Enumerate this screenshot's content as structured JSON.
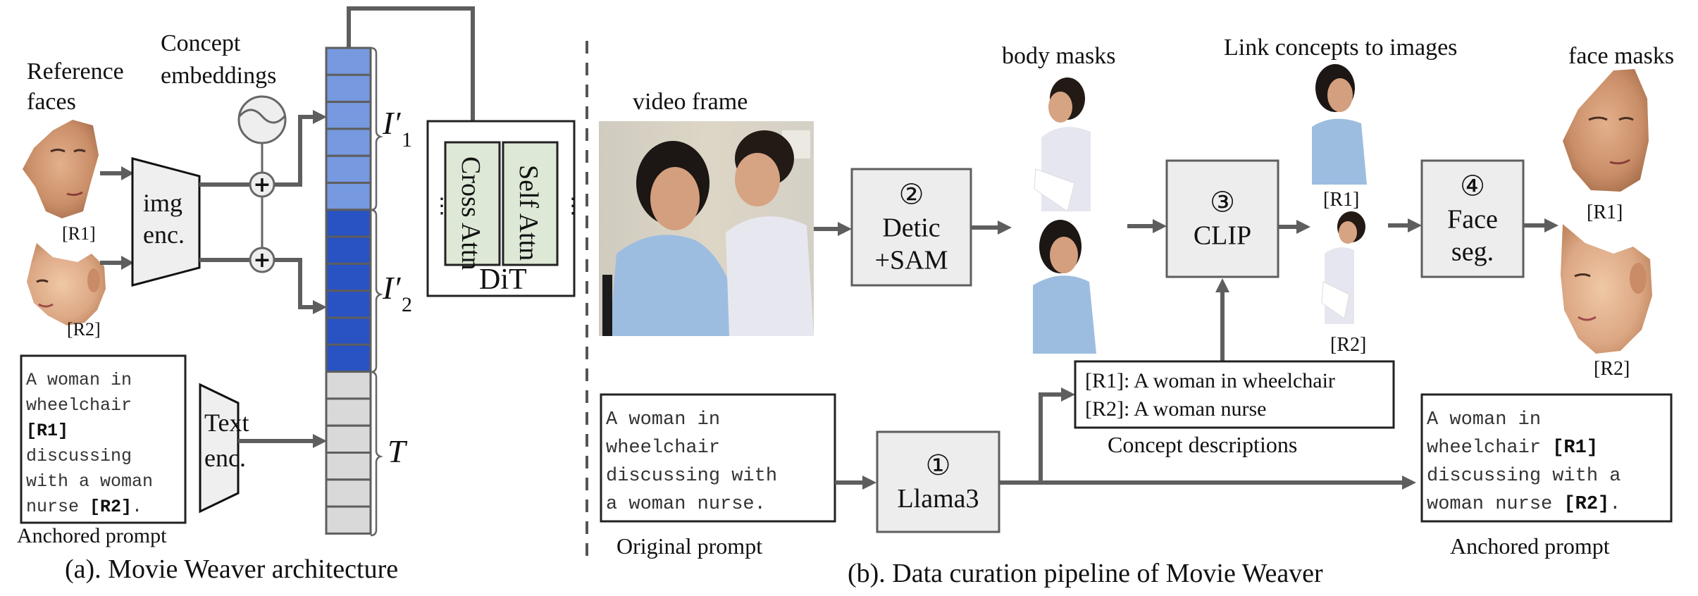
{
  "colors": {
    "token_image_1": "#7699e0",
    "token_image_2": "#2952c2",
    "token_text": "#d9d9d9",
    "module_fill": "#ededed",
    "attention_fill": "#dde8d6",
    "arrow": "#5e5e5e"
  },
  "panel_a": {
    "caption": "(a). Movie Weaver architecture",
    "reference_faces_label_line1": "Reference",
    "reference_faces_label_line2": "faces",
    "concept_embeddings_label_line1": "Concept",
    "concept_embeddings_label_line2": "embeddings",
    "face_r1_tag": "[R1]",
    "face_r2_tag": "[R2]",
    "img_encoder_line1": "img",
    "img_encoder_line2": "enc.",
    "text_encoder_line1": "Text",
    "text_encoder_line2": "enc.",
    "plus_symbol": "+",
    "token_group_labels": {
      "i1": "I′",
      "i1_sub": "1",
      "i2": "I′",
      "i2_sub": "2",
      "t": "T"
    },
    "token_counts": {
      "image_1": 6,
      "image_2": 6,
      "text": 6
    },
    "anchored_prompt": {
      "lines": [
        {
          "text": "A woman in",
          "bold": ""
        },
        {
          "text": "wheelchair",
          "bold": ""
        },
        {
          "text": "",
          "bold": "[R1]"
        },
        {
          "text": "discussing",
          "bold": ""
        },
        {
          "text": "with a woman",
          "bold": ""
        },
        {
          "text": "nurse ",
          "bold": "[R2]",
          "suffix": "."
        }
      ],
      "label": "Anchored prompt"
    },
    "dit": {
      "label": "DiT",
      "cross_attn": "Cross Attn",
      "self_attn": "Self Attn",
      "ellipsis": "⋮"
    }
  },
  "panel_b": {
    "caption": "(b). Data curation pipeline of Movie Weaver",
    "video_frame_label": "video frame",
    "body_masks_label": "body masks",
    "link_label": "Link concepts to images",
    "face_masks_label": "face masks",
    "steps": [
      {
        "number": "①",
        "name": "Llama3",
        "name2": ""
      },
      {
        "number": "②",
        "name": "Detic",
        "name2": "+SAM"
      },
      {
        "number": "③",
        "name": "CLIP",
        "name2": ""
      },
      {
        "number": "④",
        "name": "Face",
        "name2": "seg."
      }
    ],
    "linked_r1_tag": "[R1]",
    "linked_r2_tag": "[R2]",
    "face_r1_tag": "[R1]",
    "face_r2_tag": "[R2]",
    "original_prompt": {
      "lines": [
        "A woman in",
        "wheelchair",
        "discussing with",
        "a woman nurse."
      ],
      "label": "Original prompt"
    },
    "concept_descriptions": {
      "lines": [
        "[R1]: A woman in wheelchair",
        "[R2]: A woman nurse"
      ],
      "label": "Concept descriptions"
    },
    "anchored_prompt": {
      "lines": [
        {
          "text": "A woman in",
          "bold": "",
          "suffix": ""
        },
        {
          "text": "wheelchair ",
          "bold": "[R1]",
          "suffix": ""
        },
        {
          "text": "discussing with a",
          "bold": "",
          "suffix": ""
        },
        {
          "text": "woman nurse ",
          "bold": "[R2]",
          "suffix": "."
        }
      ],
      "label": "Anchored prompt"
    }
  }
}
